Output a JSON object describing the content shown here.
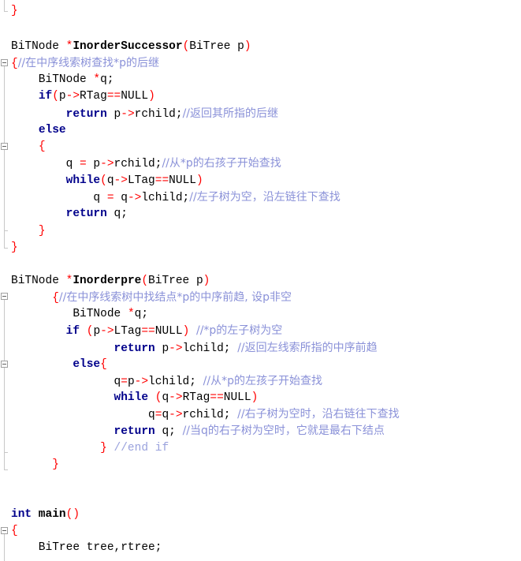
{
  "lines": [
    {
      "tokens": [
        {
          "t": "}",
          "c": "br"
        }
      ]
    },
    {
      "tokens": [
        {
          "t": "BiTNode ",
          "c": "ty"
        },
        {
          "t": "*",
          "c": "op"
        },
        {
          "t": "InorderSuccessor",
          "c": "fn"
        },
        {
          "t": "(",
          "c": "br"
        },
        {
          "t": "BiTree p",
          "c": "ty"
        },
        {
          "t": ")",
          "c": "br"
        }
      ]
    },
    {
      "tokens": [
        {
          "t": "{",
          "c": "br"
        },
        {
          "t": "//在中序线索树查找*p的后继",
          "c": "cm"
        }
      ]
    },
    {
      "tokens": [
        {
          "t": "    BiTNode ",
          "c": "ty"
        },
        {
          "t": "*",
          "c": "op"
        },
        {
          "t": "q;",
          "c": "ty"
        }
      ]
    },
    {
      "tokens": [
        {
          "t": "    ",
          "c": "ty"
        },
        {
          "t": "if",
          "c": "kw"
        },
        {
          "t": "(",
          "c": "br"
        },
        {
          "t": "p",
          "c": "ty"
        },
        {
          "t": "->",
          "c": "op"
        },
        {
          "t": "RTag",
          "c": "ty"
        },
        {
          "t": "==",
          "c": "op"
        },
        {
          "t": "NULL",
          "c": "ty"
        },
        {
          "t": ")",
          "c": "br"
        }
      ]
    },
    {
      "tokens": [
        {
          "t": "        ",
          "c": "ty"
        },
        {
          "t": "return",
          "c": "kw"
        },
        {
          "t": " p",
          "c": "ty"
        },
        {
          "t": "->",
          "c": "op"
        },
        {
          "t": "rchild;",
          "c": "ty"
        },
        {
          "t": "//返回其所指的后继",
          "c": "cm"
        }
      ]
    },
    {
      "tokens": [
        {
          "t": "    ",
          "c": "ty"
        },
        {
          "t": "else",
          "c": "kw"
        }
      ]
    },
    {
      "tokens": [
        {
          "t": "    ",
          "c": "ty"
        },
        {
          "t": "{",
          "c": "br"
        }
      ]
    },
    {
      "tokens": [
        {
          "t": "        q ",
          "c": "ty"
        },
        {
          "t": "=",
          "c": "op"
        },
        {
          "t": " p",
          "c": "ty"
        },
        {
          "t": "->",
          "c": "op"
        },
        {
          "t": "rchild;",
          "c": "ty"
        },
        {
          "t": "//从*p的右孩子开始查找",
          "c": "cm"
        }
      ]
    },
    {
      "tokens": [
        {
          "t": "        ",
          "c": "ty"
        },
        {
          "t": "while",
          "c": "kw"
        },
        {
          "t": "(",
          "c": "br"
        },
        {
          "t": "q",
          "c": "ty"
        },
        {
          "t": "->",
          "c": "op"
        },
        {
          "t": "LTag",
          "c": "ty"
        },
        {
          "t": "==",
          "c": "op"
        },
        {
          "t": "NULL",
          "c": "ty"
        },
        {
          "t": ")",
          "c": "br"
        }
      ]
    },
    {
      "tokens": [
        {
          "t": "            q ",
          "c": "ty"
        },
        {
          "t": "=",
          "c": "op"
        },
        {
          "t": " q",
          "c": "ty"
        },
        {
          "t": "->",
          "c": "op"
        },
        {
          "t": "lchild;",
          "c": "ty"
        },
        {
          "t": "//左子树为空，沿左链往下查找",
          "c": "cm"
        }
      ]
    },
    {
      "tokens": [
        {
          "t": "        ",
          "c": "ty"
        },
        {
          "t": "return",
          "c": "kw"
        },
        {
          "t": " q;",
          "c": "ty"
        }
      ]
    },
    {
      "tokens": [
        {
          "t": "    ",
          "c": "ty"
        },
        {
          "t": "}",
          "c": "br"
        }
      ]
    },
    {
      "tokens": [
        {
          "t": "}",
          "c": "br"
        }
      ]
    },
    {
      "tokens": []
    },
    {
      "tokens": [
        {
          "t": "BiTNode ",
          "c": "ty"
        },
        {
          "t": "*",
          "c": "op"
        },
        {
          "t": "Inorderpre",
          "c": "fn"
        },
        {
          "t": "(",
          "c": "br"
        },
        {
          "t": "BiTree p",
          "c": "ty"
        },
        {
          "t": ")",
          "c": "br"
        }
      ]
    },
    {
      "tokens": [
        {
          "t": "      ",
          "c": "ty"
        },
        {
          "t": "{",
          "c": "br"
        },
        {
          "t": "//在中序线索树中找结点*p的中序前趋, 设p非空",
          "c": "cm"
        }
      ]
    },
    {
      "tokens": [
        {
          "t": "         BiTNode ",
          "c": "ty"
        },
        {
          "t": "*",
          "c": "op"
        },
        {
          "t": "q;",
          "c": "ty"
        }
      ]
    },
    {
      "tokens": [
        {
          "t": "        ",
          "c": "ty"
        },
        {
          "t": "if",
          "c": "kw"
        },
        {
          "t": " (",
          "c": "br"
        },
        {
          "t": "p",
          "c": "ty"
        },
        {
          "t": "->",
          "c": "op"
        },
        {
          "t": "LTag",
          "c": "ty"
        },
        {
          "t": "==",
          "c": "op"
        },
        {
          "t": "NULL",
          "c": "ty"
        },
        {
          "t": ")",
          "c": "br"
        },
        {
          "t": " ",
          "c": "ty"
        },
        {
          "t": "//*p的左子树为空",
          "c": "cm"
        }
      ]
    },
    {
      "tokens": [
        {
          "t": "               ",
          "c": "ty"
        },
        {
          "t": "return",
          "c": "kw"
        },
        {
          "t": " p",
          "c": "ty"
        },
        {
          "t": "->",
          "c": "op"
        },
        {
          "t": "lchild; ",
          "c": "ty"
        },
        {
          "t": "//返回左线索所指的中序前趋",
          "c": "cm"
        }
      ]
    },
    {
      "tokens": [
        {
          "t": "         ",
          "c": "ty"
        },
        {
          "t": "else",
          "c": "kw"
        },
        {
          "t": "{",
          "c": "br"
        }
      ]
    },
    {
      "tokens": [
        {
          "t": "               q",
          "c": "ty"
        },
        {
          "t": "=",
          "c": "op"
        },
        {
          "t": "p",
          "c": "ty"
        },
        {
          "t": "->",
          "c": "op"
        },
        {
          "t": "lchild; ",
          "c": "ty"
        },
        {
          "t": "//从*p的左孩子开始查找",
          "c": "cm"
        }
      ]
    },
    {
      "tokens": [
        {
          "t": "               ",
          "c": "ty"
        },
        {
          "t": "while",
          "c": "kw"
        },
        {
          "t": " (",
          "c": "br"
        },
        {
          "t": "q",
          "c": "ty"
        },
        {
          "t": "->",
          "c": "op"
        },
        {
          "t": "RTag",
          "c": "ty"
        },
        {
          "t": "==",
          "c": "op"
        },
        {
          "t": "NULL",
          "c": "ty"
        },
        {
          "t": ")",
          "c": "br"
        }
      ]
    },
    {
      "tokens": [
        {
          "t": "                    q",
          "c": "ty"
        },
        {
          "t": "=",
          "c": "op"
        },
        {
          "t": "q",
          "c": "ty"
        },
        {
          "t": "->",
          "c": "op"
        },
        {
          "t": "rchild; ",
          "c": "ty"
        },
        {
          "t": "//右子树为空时，沿右链往下查找",
          "c": "cm"
        }
      ]
    },
    {
      "tokens": [
        {
          "t": "               ",
          "c": "ty"
        },
        {
          "t": "return",
          "c": "kw"
        },
        {
          "t": " q; ",
          "c": "ty"
        },
        {
          "t": "//当q的右子树为空时，它就是最右下结点",
          "c": "cm"
        }
      ]
    },
    {
      "tokens": [
        {
          "t": "             ",
          "c": "ty"
        },
        {
          "t": "}",
          "c": "br"
        },
        {
          "t": " ",
          "c": "ty"
        },
        {
          "t": "//end if",
          "c": "cmm"
        }
      ]
    },
    {
      "tokens": [
        {
          "t": "      ",
          "c": "ty"
        },
        {
          "t": "}",
          "c": "br"
        }
      ]
    },
    {
      "tokens": []
    },
    {
      "tokens": []
    },
    {
      "tokens": [
        {
          "t": "int",
          "c": "kw"
        },
        {
          "t": " main",
          "c": "fn"
        },
        {
          "t": "()",
          "c": "br"
        }
      ]
    },
    {
      "tokens": [
        {
          "t": "{",
          "c": "br"
        }
      ]
    },
    {
      "tokens": [
        {
          "t": "    BiTree tree,rtree;",
          "c": "ty"
        }
      ]
    }
  ]
}
